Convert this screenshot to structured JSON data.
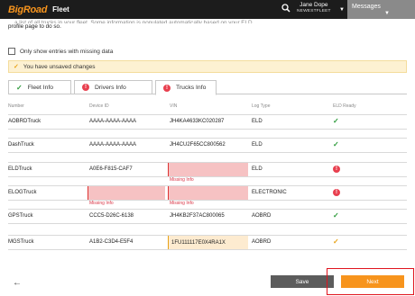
{
  "header": {
    "logo_part1": "Big",
    "logo_part2": "Road",
    "app_name": "Fleet",
    "user_name": "Jane Dope",
    "user_org": "NEWESTFLEET",
    "messages_label": "Messages"
  },
  "intro": {
    "clipped_line": "... a list of all trucks in your fleet. Some information is populated automatically based on your ELD...",
    "text": "profile page to do so."
  },
  "filter": {
    "label": "Only show entries with missing data",
    "checked": false
  },
  "warning": {
    "text": "You have unsaved changes"
  },
  "tabs": [
    {
      "label": "Fleet Info",
      "state": "complete"
    },
    {
      "label": "Drivers Info",
      "state": "error"
    },
    {
      "label": "Trucks Info",
      "state": "error",
      "active": true
    }
  ],
  "columns": [
    "Number",
    "Device ID",
    "VIN",
    "Log Type",
    "ELD Ready"
  ],
  "missing_label": "Missing Info",
  "rows": [
    {
      "number": "AOBRDTruck",
      "device_id": "AAAA-AAAA-AAAA",
      "vin": "JH4KA4633KC020287",
      "log_type": "ELD",
      "eld_ready": "ok"
    },
    {
      "number": "DashTruck",
      "device_id": "AAAA-AAAA-AAAA",
      "vin": "JH4CU2F65CC800562",
      "log_type": "ELD",
      "eld_ready": "ok"
    },
    {
      "number": "ELDTruck",
      "device_id": "A0E6-F815-CAF7",
      "vin": "",
      "log_type": "ELD",
      "eld_ready": "error",
      "vin_missing": true
    },
    {
      "number": "ELOGTruck",
      "device_id": "",
      "vin": "",
      "log_type": "ELECTRONIC",
      "eld_ready": "error",
      "device_missing": true,
      "vin_missing": true
    },
    {
      "number": "GPSTruck",
      "device_id": "CCC5-D26C-6138",
      "vin": "JH4KB2F37AC800065",
      "log_type": "AOBRD",
      "eld_ready": "ok"
    },
    {
      "number": "MGSTruck",
      "device_id": "A1B2-C3D4-E5F4",
      "vin": "1FU111117E0X4RA1X",
      "log_type": "AOBRD",
      "eld_ready": "warn",
      "vin_warning": true
    }
  ],
  "footer": {
    "save_label": "Save",
    "next_label": "Next"
  },
  "colors": {
    "brand_orange": "#f7941d",
    "topbar": "#1c1c1c",
    "ok_green": "#2c9a3a",
    "error_red": "#e8404f"
  }
}
